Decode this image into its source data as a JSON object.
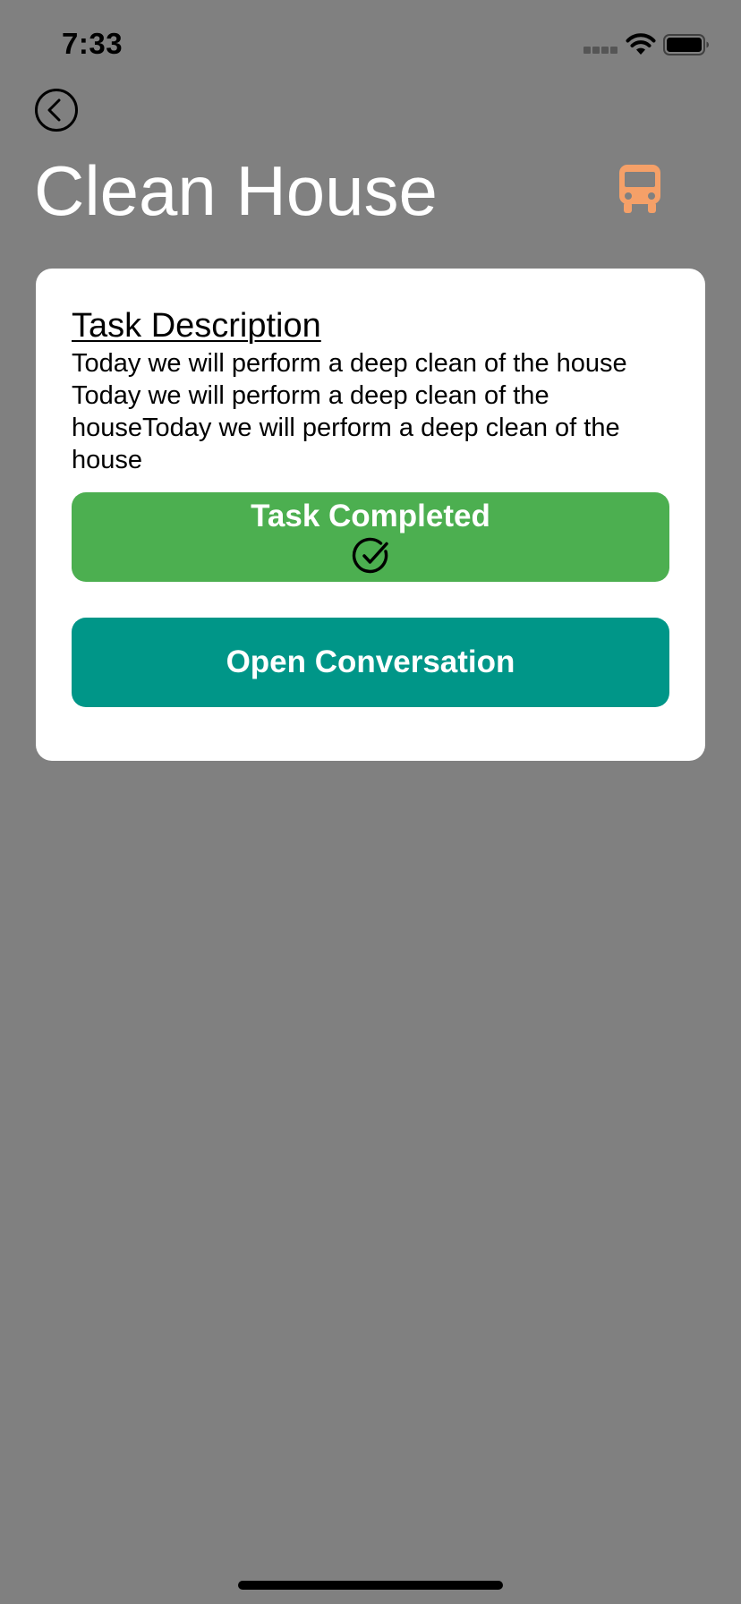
{
  "status_bar": {
    "time": "7:33"
  },
  "header": {
    "title": "Clean House",
    "back_icon": "chevron-left-circle-icon",
    "action_icon": "bus-icon",
    "action_color": "#f5a068"
  },
  "card": {
    "heading": "Task Description",
    "description": "Today we will perform a deep clean of the house Today we will perform a deep clean of the houseToday we will perform a deep clean of the house",
    "completed_button": {
      "label": "Task Completed",
      "icon": "check-circle-icon",
      "color": "#4caf50"
    },
    "conversation_button": {
      "label": "Open Conversation",
      "color": "#009688"
    }
  },
  "colors": {
    "background": "#808080",
    "card": "#ffffff"
  }
}
